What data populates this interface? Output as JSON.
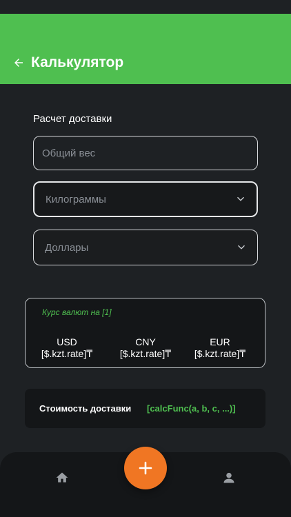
{
  "header": {
    "title": "Калькулятор",
    "back_icon": "arrow-left-icon"
  },
  "form": {
    "section_title": "Расчет доставки",
    "weight_placeholder": "Общий вес",
    "unit_select": "Килограммы",
    "currency_select": "Доллары"
  },
  "rates": {
    "title": "Курс валют на [1]",
    "items": [
      {
        "code": "USD",
        "value": "[$.kzt.rate]₸"
      },
      {
        "code": "CNY",
        "value": "[$.kzt.rate]₸"
      },
      {
        "code": "EUR",
        "value": "[$.kzt.rate]₸"
      }
    ]
  },
  "cost": {
    "label": "Стоимость доставки",
    "value": "[calcFunc(a, b, c, ...)]"
  },
  "nav": {
    "home_icon": "home-icon",
    "add_icon": "plus-icon",
    "profile_icon": "user-icon"
  },
  "colors": {
    "accent_green": "#4fbf50",
    "fab_orange": "#f07623",
    "background": "#1e2124",
    "card": "#141618"
  }
}
